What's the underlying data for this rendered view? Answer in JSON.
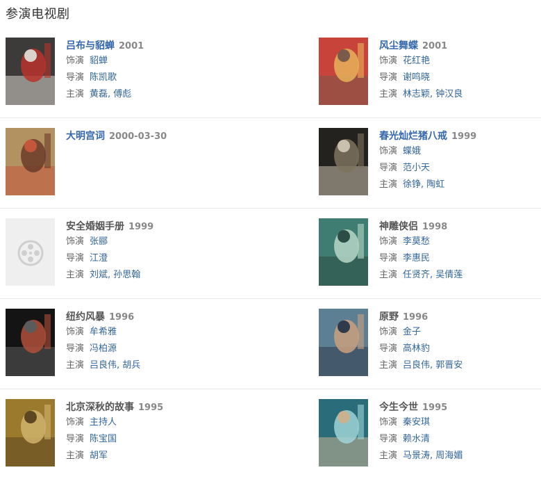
{
  "section_title": "参演电视剧",
  "labels": {
    "role": "饰演",
    "director": "导演",
    "cast": "主演"
  },
  "items": [
    {
      "title": "吕布与貂蝉",
      "year": "2001",
      "title_style": "linked",
      "role": "貂蝉",
      "director": "陈凯歌",
      "cast": "黄磊, 傅彪",
      "poster": "poster-1",
      "colors": [
        "#3d3b39",
        "#b8332b",
        "#d9d3cc"
      ]
    },
    {
      "title": "风尘舞蝶",
      "year": "2001",
      "title_style": "linked",
      "role": "花红艳",
      "director": "谢鸣晓",
      "cast": "林志颖, 钟汉良",
      "poster": "poster-2",
      "colors": [
        "#c8443a",
        "#e7b25a",
        "#7a5a4a"
      ]
    },
    {
      "title": "大明宫词",
      "year": "2000-03-30",
      "title_style": "linked",
      "role": "",
      "director": "",
      "cast": "",
      "poster": "poster-3",
      "colors": [
        "#b39262",
        "#6b3b2a",
        "#c4563b"
      ]
    },
    {
      "title": "春光灿烂猪八戒",
      "year": "1999",
      "title_style": "linked",
      "role": "蝶娥",
      "director": "范小天",
      "cast": "徐铮, 陶虹",
      "poster": "poster-4",
      "colors": [
        "#24221f",
        "#7d735d",
        "#c9c0ad"
      ]
    },
    {
      "title": "安全婚姻手册",
      "year": "1999",
      "title_style": "plain",
      "role": "张郦",
      "director": "江澄",
      "cast": "刘斌, 孙思翰",
      "poster": "placeholder",
      "colors": [
        "#efefef",
        "#d6d6d6",
        "#cfcfcf"
      ]
    },
    {
      "title": "神雕侠侣",
      "year": "1998",
      "title_style": "plain",
      "role": "李莫愁",
      "director": "李惠民",
      "cast": "任贤齐, 吴倩莲",
      "poster": "poster-6",
      "colors": [
        "#3f7c71",
        "#b6d7c7",
        "#2b4d45"
      ]
    },
    {
      "title": "纽约风暴",
      "year": "1996",
      "title_style": "plain",
      "role": "牟希雅",
      "director": "冯柏源",
      "cast": "吕良伟, 胡兵",
      "poster": "poster-7",
      "colors": [
        "#141414",
        "#b14f3b",
        "#5b5b5b"
      ]
    },
    {
      "title": "原野",
      "year": "1996",
      "title_style": "plain",
      "role": "金子",
      "director": "高林豹",
      "cast": "吕良伟, 郭晋安",
      "poster": "poster-8",
      "colors": [
        "#5d7f94",
        "#c9a07e",
        "#2f3b4a"
      ]
    },
    {
      "title": "北京深秋的故事",
      "year": "1995",
      "title_style": "plain",
      "role": "主持人",
      "director": "陈宝国",
      "cast": "胡军",
      "poster": "poster-9",
      "colors": [
        "#9c7a2d",
        "#d0b46c",
        "#5b4721"
      ]
    },
    {
      "title": "今生今世",
      "year": "1995",
      "title_style": "plain",
      "role": "秦安琪",
      "director": "赖水清",
      "cast": "马景涛, 周海媚",
      "poster": "poster-10",
      "colors": [
        "#2b6c7a",
        "#9fd4d6",
        "#c8b28f"
      ]
    }
  ]
}
